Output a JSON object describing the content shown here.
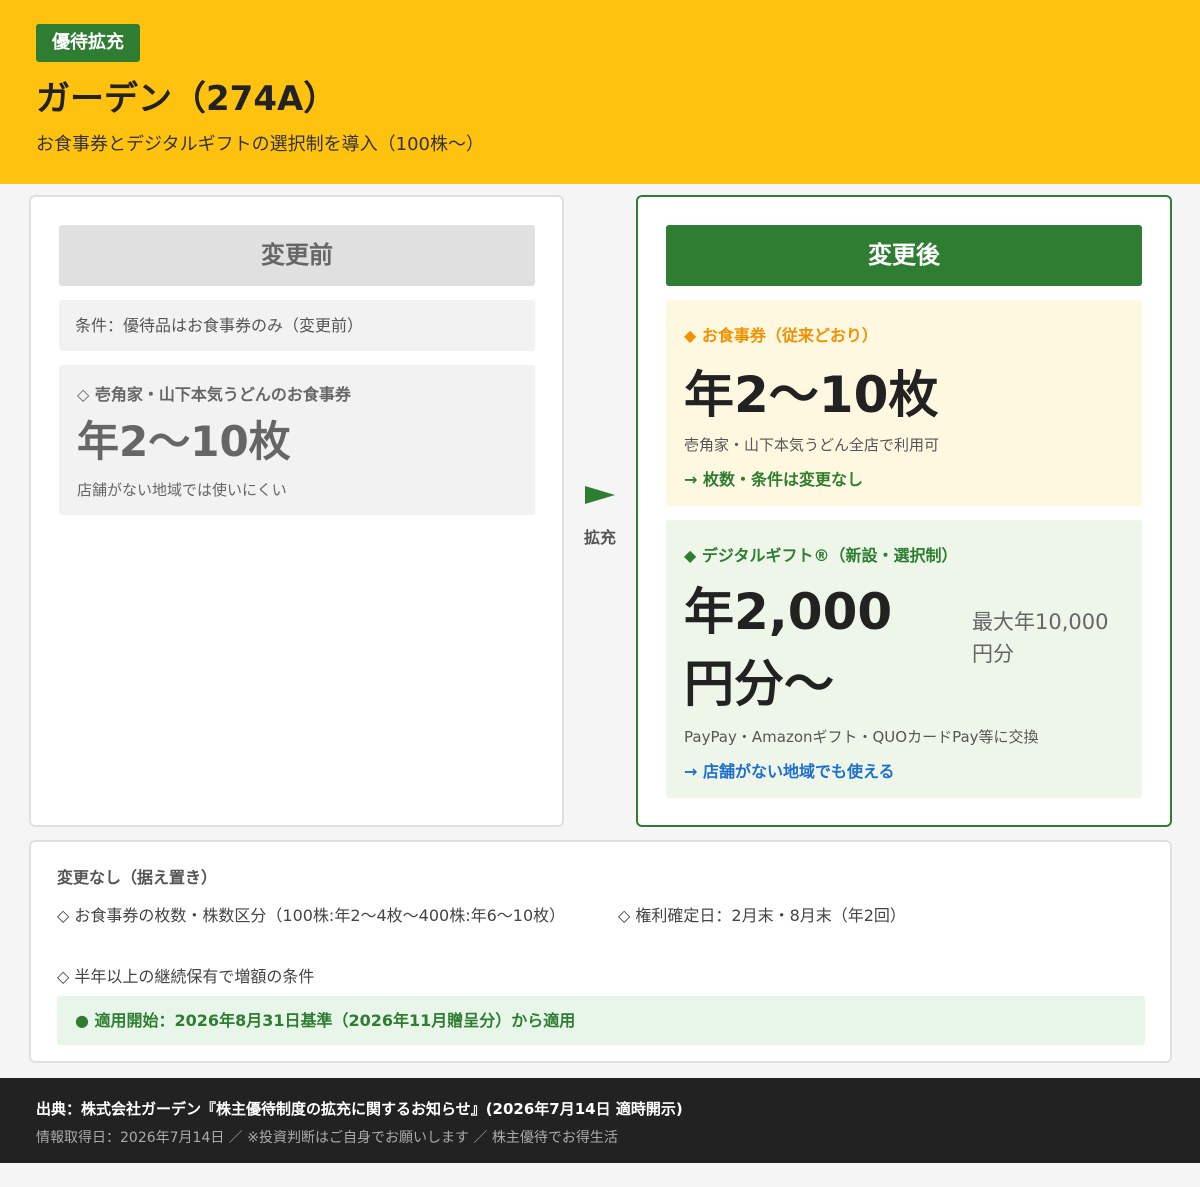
{
  "header": {
    "badge": "優待拡充",
    "title": "ガーデン（274A）",
    "subtitle": "お食事券とデジタルギフトの選択制を導入（100株〜）"
  },
  "before": {
    "header": "変更前",
    "condition": "条件：優待品はお食事券のみ（変更前）",
    "box_title": "◇ 壱角家・山下本気うどんのお食事券",
    "big": "年2〜10枚",
    "note": "店舗がない地域では使いにくい"
  },
  "arrow": {
    "label": "拡充"
  },
  "after": {
    "header": "変更後",
    "meal": {
      "title": "◆ お食事券（従来どおり）",
      "big": "年2〜10枚",
      "note": "壱角家・山下本気うどん全店で利用可",
      "link": "→ 枚数・条件は変更なし"
    },
    "gift": {
      "title": "◆ デジタルギフト®（新設・選択制）",
      "big": "年2,000円分〜",
      "max": "最大年10,000円分",
      "note": "PayPay・Amazonギフト・QUOカードPay等に交換",
      "link": "→ 店舗がない地域でも使える"
    }
  },
  "unchanged": {
    "title": "変更なし（据え置き）",
    "items": [
      "◇ お食事券の枚数・株数区分（100株:年2〜4枚〜400株:年6〜10枚）",
      "◇ 権利確定日：2月末・8月末（年2回）",
      "◇ 半年以上の継続保有で増額の条件"
    ],
    "apply": "● 適用開始：2026年8月31日基準（2026年11月贈呈分）から適用"
  },
  "footer": {
    "source": "出典：株式会社ガーデン『株主優待制度の拡充に関するお知らせ』(2026年7月14日 適時開示)",
    "info": "情報取得日：2026年7月14日 ／ ※投資判断はご自身でお願いします ／ 株主優待でお得生活"
  },
  "colors": {
    "header_bg": "#ffc20e",
    "accent_green": "#2e7d32",
    "meal_orange": "#f29100",
    "link_blue": "#1e6fcf"
  }
}
